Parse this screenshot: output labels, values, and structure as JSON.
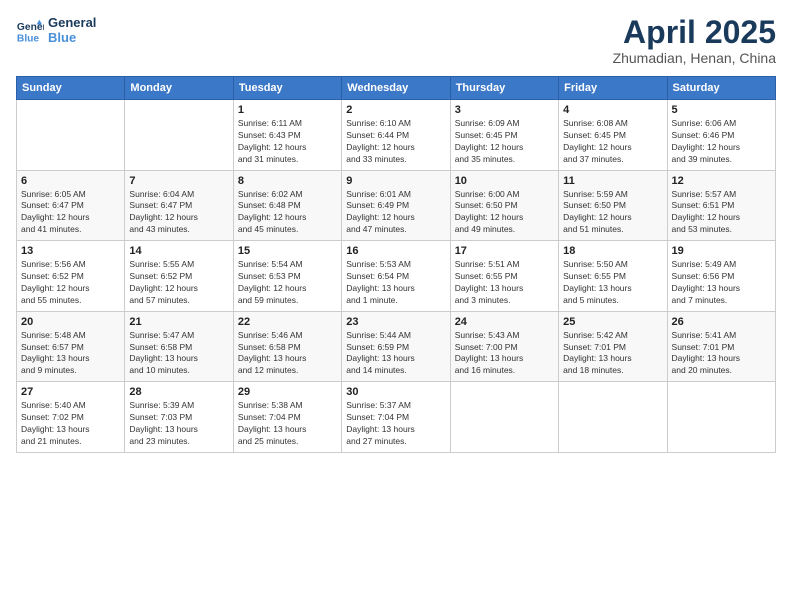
{
  "header": {
    "logo_line1": "General",
    "logo_line2": "Blue",
    "month_title": "April 2025",
    "subtitle": "Zhumadian, Henan, China"
  },
  "weekdays": [
    "Sunday",
    "Monday",
    "Tuesday",
    "Wednesday",
    "Thursday",
    "Friday",
    "Saturday"
  ],
  "weeks": [
    [
      {
        "day": "",
        "info": ""
      },
      {
        "day": "",
        "info": ""
      },
      {
        "day": "1",
        "info": "Sunrise: 6:11 AM\nSunset: 6:43 PM\nDaylight: 12 hours\nand 31 minutes."
      },
      {
        "day": "2",
        "info": "Sunrise: 6:10 AM\nSunset: 6:44 PM\nDaylight: 12 hours\nand 33 minutes."
      },
      {
        "day": "3",
        "info": "Sunrise: 6:09 AM\nSunset: 6:45 PM\nDaylight: 12 hours\nand 35 minutes."
      },
      {
        "day": "4",
        "info": "Sunrise: 6:08 AM\nSunset: 6:45 PM\nDaylight: 12 hours\nand 37 minutes."
      },
      {
        "day": "5",
        "info": "Sunrise: 6:06 AM\nSunset: 6:46 PM\nDaylight: 12 hours\nand 39 minutes."
      }
    ],
    [
      {
        "day": "6",
        "info": "Sunrise: 6:05 AM\nSunset: 6:47 PM\nDaylight: 12 hours\nand 41 minutes."
      },
      {
        "day": "7",
        "info": "Sunrise: 6:04 AM\nSunset: 6:47 PM\nDaylight: 12 hours\nand 43 minutes."
      },
      {
        "day": "8",
        "info": "Sunrise: 6:02 AM\nSunset: 6:48 PM\nDaylight: 12 hours\nand 45 minutes."
      },
      {
        "day": "9",
        "info": "Sunrise: 6:01 AM\nSunset: 6:49 PM\nDaylight: 12 hours\nand 47 minutes."
      },
      {
        "day": "10",
        "info": "Sunrise: 6:00 AM\nSunset: 6:50 PM\nDaylight: 12 hours\nand 49 minutes."
      },
      {
        "day": "11",
        "info": "Sunrise: 5:59 AM\nSunset: 6:50 PM\nDaylight: 12 hours\nand 51 minutes."
      },
      {
        "day": "12",
        "info": "Sunrise: 5:57 AM\nSunset: 6:51 PM\nDaylight: 12 hours\nand 53 minutes."
      }
    ],
    [
      {
        "day": "13",
        "info": "Sunrise: 5:56 AM\nSunset: 6:52 PM\nDaylight: 12 hours\nand 55 minutes."
      },
      {
        "day": "14",
        "info": "Sunrise: 5:55 AM\nSunset: 6:52 PM\nDaylight: 12 hours\nand 57 minutes."
      },
      {
        "day": "15",
        "info": "Sunrise: 5:54 AM\nSunset: 6:53 PM\nDaylight: 12 hours\nand 59 minutes."
      },
      {
        "day": "16",
        "info": "Sunrise: 5:53 AM\nSunset: 6:54 PM\nDaylight: 13 hours\nand 1 minute."
      },
      {
        "day": "17",
        "info": "Sunrise: 5:51 AM\nSunset: 6:55 PM\nDaylight: 13 hours\nand 3 minutes."
      },
      {
        "day": "18",
        "info": "Sunrise: 5:50 AM\nSunset: 6:55 PM\nDaylight: 13 hours\nand 5 minutes."
      },
      {
        "day": "19",
        "info": "Sunrise: 5:49 AM\nSunset: 6:56 PM\nDaylight: 13 hours\nand 7 minutes."
      }
    ],
    [
      {
        "day": "20",
        "info": "Sunrise: 5:48 AM\nSunset: 6:57 PM\nDaylight: 13 hours\nand 9 minutes."
      },
      {
        "day": "21",
        "info": "Sunrise: 5:47 AM\nSunset: 6:58 PM\nDaylight: 13 hours\nand 10 minutes."
      },
      {
        "day": "22",
        "info": "Sunrise: 5:46 AM\nSunset: 6:58 PM\nDaylight: 13 hours\nand 12 minutes."
      },
      {
        "day": "23",
        "info": "Sunrise: 5:44 AM\nSunset: 6:59 PM\nDaylight: 13 hours\nand 14 minutes."
      },
      {
        "day": "24",
        "info": "Sunrise: 5:43 AM\nSunset: 7:00 PM\nDaylight: 13 hours\nand 16 minutes."
      },
      {
        "day": "25",
        "info": "Sunrise: 5:42 AM\nSunset: 7:01 PM\nDaylight: 13 hours\nand 18 minutes."
      },
      {
        "day": "26",
        "info": "Sunrise: 5:41 AM\nSunset: 7:01 PM\nDaylight: 13 hours\nand 20 minutes."
      }
    ],
    [
      {
        "day": "27",
        "info": "Sunrise: 5:40 AM\nSunset: 7:02 PM\nDaylight: 13 hours\nand 21 minutes."
      },
      {
        "day": "28",
        "info": "Sunrise: 5:39 AM\nSunset: 7:03 PM\nDaylight: 13 hours\nand 23 minutes."
      },
      {
        "day": "29",
        "info": "Sunrise: 5:38 AM\nSunset: 7:04 PM\nDaylight: 13 hours\nand 25 minutes."
      },
      {
        "day": "30",
        "info": "Sunrise: 5:37 AM\nSunset: 7:04 PM\nDaylight: 13 hours\nand 27 minutes."
      },
      {
        "day": "",
        "info": ""
      },
      {
        "day": "",
        "info": ""
      },
      {
        "day": "",
        "info": ""
      }
    ]
  ]
}
